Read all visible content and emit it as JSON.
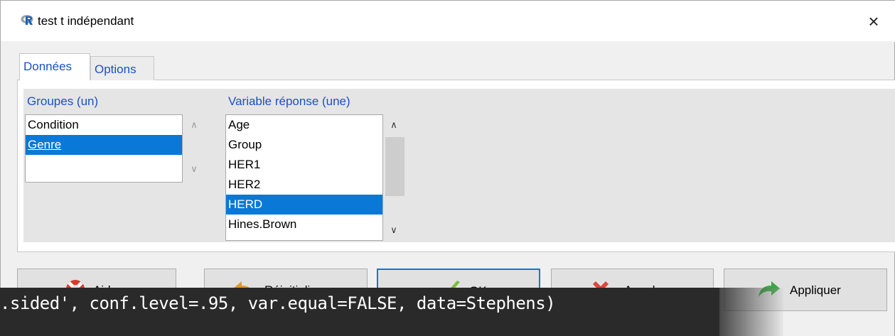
{
  "window": {
    "title": "test t indépendant",
    "close_glyph": "×"
  },
  "tabs": [
    {
      "label": "Données",
      "active": true
    },
    {
      "label": "Options",
      "active": false
    }
  ],
  "groups": {
    "label": "Groupes (un)",
    "items": [
      "Condition",
      "Genre"
    ],
    "selected": "Genre"
  },
  "response": {
    "label": "Variable réponse (une)",
    "items": [
      "Age",
      "Group",
      "HER1",
      "HER2",
      "HERD",
      "Hines.Brown"
    ],
    "selected": "HERD"
  },
  "buttons": {
    "help": "Aide",
    "reset": "Réinitialiser",
    "ok": "OK",
    "cancel": "Annuler",
    "apply": "Appliquer"
  },
  "console": {
    "text": ".sided', conf.level=.95, var.equal=FALSE, data=Stephens)"
  },
  "colors": {
    "accent": "#0a78d7",
    "label_blue": "#1a50c8",
    "console_bg": "#2a2a2a"
  }
}
